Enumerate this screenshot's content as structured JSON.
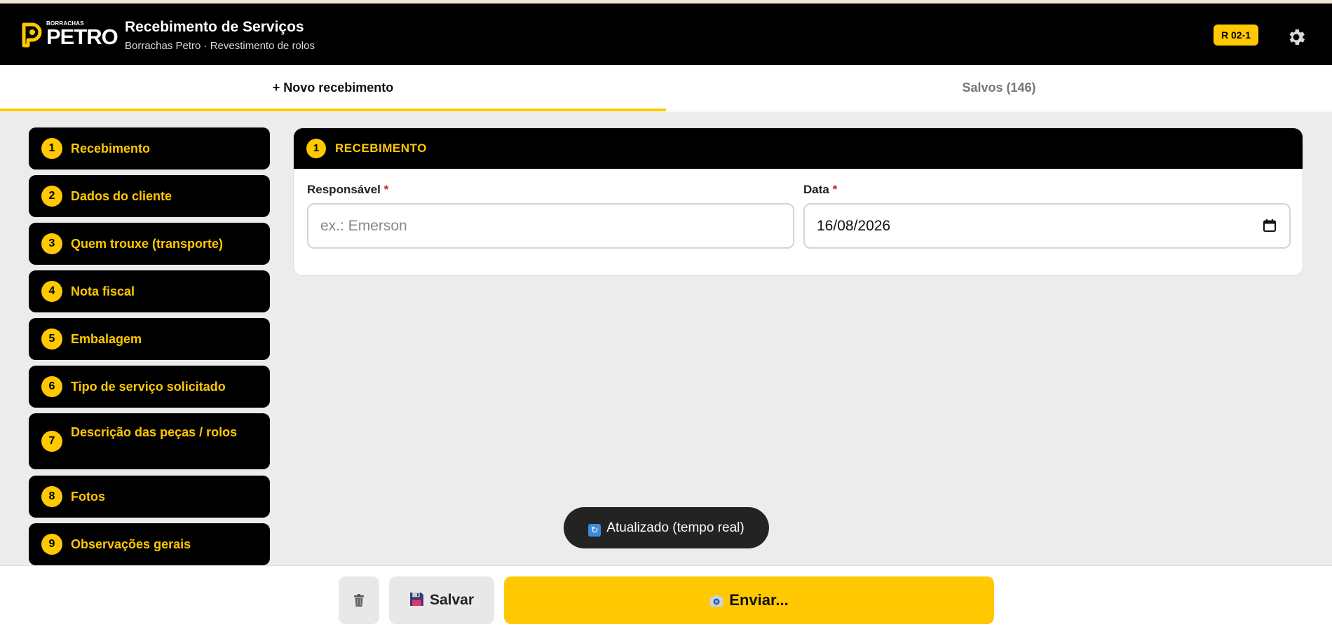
{
  "header": {
    "logo_small": "BORRACHAS",
    "logo_word": "PETRO",
    "title": "Recebimento de Serviços",
    "subtitle": "Borrachas Petro · Revestimento de rolos",
    "code_badge": "R 02-1",
    "settings_icon": "gear-icon",
    "colors": {
      "accent": "#ffc800",
      "bar": "#000000"
    }
  },
  "tabs": [
    {
      "label": "+ Novo recebimento",
      "active": true
    },
    {
      "label": "Salvos (146)",
      "active": false
    }
  ],
  "sidebar": {
    "items": [
      {
        "num": "1",
        "label": "Recebimento"
      },
      {
        "num": "2",
        "label": "Dados do cliente"
      },
      {
        "num": "3",
        "label": "Quem trouxe (transporte)"
      },
      {
        "num": "4",
        "label": "Nota fiscal"
      },
      {
        "num": "5",
        "label": "Embalagem"
      },
      {
        "num": "6",
        "label": "Tipo de serviço solicitado"
      },
      {
        "num": "7",
        "label": "Descrição das peças / rolos"
      },
      {
        "num": "8",
        "label": "Fotos"
      },
      {
        "num": "9",
        "label": "Observações gerais"
      }
    ]
  },
  "section": {
    "num": "1",
    "title": "RECEBIMENTO",
    "fields": {
      "responsavel": {
        "label": "Responsável",
        "required_mark": "*",
        "value": "",
        "placeholder": "ex.: Emerson"
      },
      "data": {
        "label": "Data",
        "required_mark": "*",
        "value": "16/08/2026",
        "icon": "calendar-icon"
      }
    }
  },
  "toast": {
    "icon": "refresh-icon",
    "text": "Atualizado (tempo real)"
  },
  "actions": {
    "trash_icon": "trash-icon",
    "save_label": "Salvar",
    "save_icon": "floppy-disk-icon",
    "send_label": "Enviar...",
    "send_icon": "camera-icon"
  }
}
